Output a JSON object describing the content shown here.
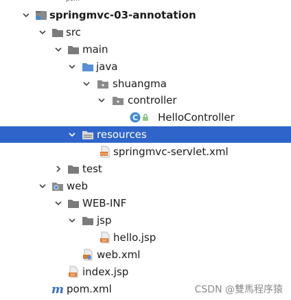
{
  "colors": {
    "selection_bg": "#2f65ca",
    "folder_gray": "#7b7b7b",
    "source_folder_blue": "#5a8fd6",
    "class_badge": "#3f8ad6",
    "xml_orange": "#e07a2b",
    "maven_blue": "#3a6ec6"
  },
  "tree": {
    "clipped_top_text": "pom",
    "project": {
      "name": "springmvc-03-annotation",
      "icon": "module-icon"
    },
    "src": {
      "name": "src",
      "icon": "folder-icon"
    },
    "main": {
      "name": "main",
      "icon": "folder-icon"
    },
    "java": {
      "name": "java",
      "icon": "source-folder-icon"
    },
    "shuangma": {
      "name": "shuangma",
      "icon": "package-icon"
    },
    "controller": {
      "name": "controller",
      "icon": "package-icon"
    },
    "hello_controller": {
      "name": "HelloController",
      "icon": "class-icon",
      "badge": "C"
    },
    "resources": {
      "name": "resources",
      "icon": "resources-folder-icon"
    },
    "springmvc_servlet": {
      "name": "springmvc-servlet.xml",
      "icon": "xml-file-icon"
    },
    "test": {
      "name": "test",
      "icon": "folder-icon"
    },
    "web": {
      "name": "web",
      "icon": "web-folder-icon"
    },
    "web_inf": {
      "name": "WEB-INF",
      "icon": "folder-icon"
    },
    "jsp": {
      "name": "jsp",
      "icon": "folder-icon"
    },
    "hello_jsp": {
      "name": "hello.jsp",
      "icon": "jsp-file-icon"
    },
    "web_xml": {
      "name": "web.xml",
      "icon": "xml-file-icon"
    },
    "index_jsp": {
      "name": "index.jsp",
      "icon": "jsp-file-icon"
    },
    "pom_xml": {
      "name": "pom.xml",
      "icon": "maven-file-icon",
      "badge": "m"
    }
  },
  "watermark": "CSDN @雙馬程序猿"
}
